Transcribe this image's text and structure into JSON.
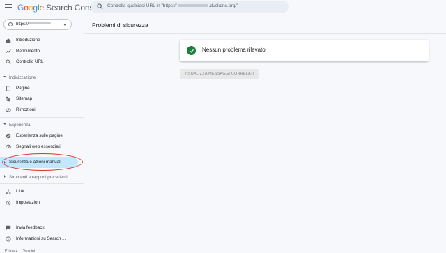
{
  "header": {
    "logo_google": [
      "G",
      "o",
      "o",
      "g",
      "l",
      "e"
    ],
    "product": "Search Console",
    "search_placeholder_prefix": "Controlla qualsiasi URL in \"https://",
    "search_placeholder_suffix": ".duckdns.org/\""
  },
  "property": {
    "label": "https://"
  },
  "sidebar": {
    "overview": "Introduzione",
    "performance": "Rendimento",
    "url_inspection": "Controllo URL",
    "indexing_section": "Indicizzazione",
    "pages": "Pagine",
    "sitemaps": "Sitemap",
    "removals": "Rimozioni",
    "experience_section": "Esperienza",
    "page_experience": "Esperienza sulle pagine",
    "core_web_vitals": "Segnali web essenziali",
    "security_manual": "Sicurezza e azioni manuali",
    "legacy_section": "Strumenti e rapporti precedenti",
    "links": "Link",
    "settings": "Impostazioni",
    "feedback": "Invia feedback",
    "about": "Informazioni su Search ..."
  },
  "main": {
    "title": "Problemi di sicurezza",
    "status_message": "Nessun problema rilevato",
    "related_messages_button": "VISUALIZZA MESSAGGI CORRELATI"
  },
  "footer": {
    "privacy": "Privacy",
    "terms": "Termini"
  },
  "colors": {
    "accent_active": "#c2e7ff",
    "success": "#188038",
    "annotation": "#d93025"
  }
}
